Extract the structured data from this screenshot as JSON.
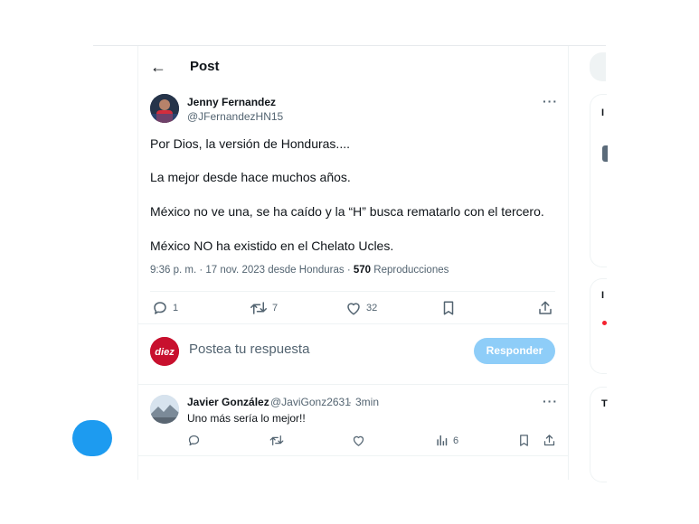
{
  "post_header": {
    "title": "Post"
  },
  "main_tweet": {
    "author_name": "Jenny Fernandez",
    "author_handle": "@JFernandezHN15",
    "lines": [
      "Por Dios, la versión de Honduras....",
      "La mejor desde hace muchos años.",
      "México no ve una, se ha caído y la “H” busca rematarlo con el tercero.",
      "México NO ha existido en el Chelato Ucles."
    ],
    "time": "9:36 p. m.",
    "date": "17 nov. 2023",
    "location": "desde Honduras",
    "views_count": "570",
    "views_label": "Reproducciones",
    "replies": "1",
    "retweets": "7",
    "likes": "32"
  },
  "composer": {
    "avatar_text": "diez",
    "placeholder": "Postea tu respuesta",
    "button_label": "Responder"
  },
  "reply_tweet": {
    "author_name": "Javier González",
    "author_handle": "@JaviGonz2631",
    "time": "3min",
    "text": "Uno más sería lo mejor!!",
    "views": "6"
  },
  "colors": {
    "accent": "#1d9bf0",
    "accent_disabled": "#8ecdf8",
    "brand_red": "#c8102e"
  }
}
